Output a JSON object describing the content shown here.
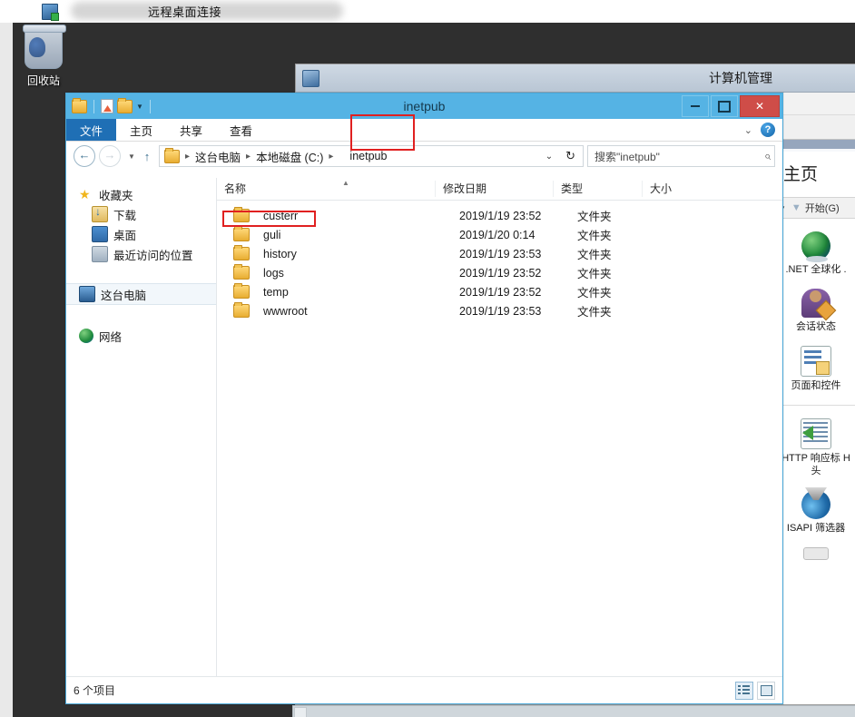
{
  "rdp": {
    "title": "远程桌面连接",
    "icon": "remote-desktop-icon"
  },
  "desktop": {
    "recycle_bin_label": "回收站",
    "recycle_bin_icon": "recycle-bin-icon"
  },
  "computer_management": {
    "title": "计算机管理",
    "icon": "computer-management-icon",
    "home_heading": "主页",
    "filter": {
      "caret_icon": "chevron-down-icon",
      "funnel_icon": "filter-funnel-icon",
      "label": "开始(G)"
    },
    "feature_groups": [
      {
        "items": [
          {
            "icon": "globe-icon",
            "label": ".NET 全球化 ."
          },
          {
            "icon": "session-person-icon",
            "label": "会话状态"
          },
          {
            "icon": "pages-controls-icon",
            "label": "页面和控件"
          }
        ]
      },
      {
        "items": [
          {
            "icon": "http-response-headers-icon",
            "label": "HTTP 响应标 H\n头"
          },
          {
            "icon": "isapi-filter-icon",
            "label": "ISAPI 筛选器"
          }
        ]
      }
    ]
  },
  "explorer": {
    "title": "inetpub",
    "quick_access": [
      {
        "icon": "folder-icon",
        "name": "save-folder-button"
      },
      {
        "icon": "new-document-icon",
        "name": "properties-button"
      },
      {
        "icon": "folder-icon",
        "name": "new-folder-button"
      },
      {
        "icon": "chevron-down-icon",
        "name": "customize-qat-button"
      }
    ],
    "window_buttons": {
      "minimize": "minimize-button",
      "maximize": "maximize-button",
      "close_label": "✕"
    },
    "ribbon_tabs": [
      {
        "label": "文件",
        "active": true
      },
      {
        "label": "主页",
        "active": false
      },
      {
        "label": "共享",
        "active": false
      },
      {
        "label": "查看",
        "active": false
      }
    ],
    "ribbon_right": {
      "collapse_icon": "chevron-down-icon",
      "help_icon": "help-icon",
      "help_glyph": "?"
    },
    "address_bar": {
      "back_glyph": "←",
      "forward_glyph": "→",
      "recent_caret": "▼",
      "up_glyph": "↑",
      "crumbs": [
        "这台电脑",
        "本地磁盘 (C:)",
        "inetpub"
      ],
      "crumb_separator": "▸",
      "dropdown_caret": "⌄",
      "refresh_glyph": "↻"
    },
    "search": {
      "text": "搜索\"inetpub\"",
      "icon": "search-magnifier-icon"
    },
    "nav_pane": [
      {
        "label": "收藏夹",
        "icon": "favorites-star-icon",
        "indent": 0,
        "selected": false
      },
      {
        "label": "下载",
        "icon": "downloads-icon",
        "indent": 1,
        "selected": false
      },
      {
        "label": "桌面",
        "icon": "desktop-icon",
        "indent": 1,
        "selected": false
      },
      {
        "label": "最近访问的位置",
        "icon": "recent-places-icon",
        "indent": 1,
        "selected": false
      },
      {
        "label": "这台电脑",
        "icon": "this-pc-icon",
        "indent": 0,
        "selected": true
      },
      {
        "label": "网络",
        "icon": "network-icon",
        "indent": 0,
        "selected": false
      }
    ],
    "columns": [
      "名称",
      "修改日期",
      "类型",
      "大小"
    ],
    "sort_indicator": "▲",
    "rows": [
      {
        "name": "custerr",
        "date": "2019/1/19 23:52",
        "type": "文件夹",
        "size": ""
      },
      {
        "name": "guli",
        "date": "2019/1/20 0:14",
        "type": "文件夹",
        "size": ""
      },
      {
        "name": "history",
        "date": "2019/1/19 23:53",
        "type": "文件夹",
        "size": ""
      },
      {
        "name": "logs",
        "date": "2019/1/19 23:52",
        "type": "文件夹",
        "size": ""
      },
      {
        "name": "temp",
        "date": "2019/1/19 23:52",
        "type": "文件夹",
        "size": ""
      },
      {
        "name": "wwwroot",
        "date": "2019/1/19 23:53",
        "type": "文件夹",
        "size": ""
      }
    ],
    "status": {
      "item_count_text": "6 个项目",
      "details_view": "details-view-button",
      "large_icons_view": "large-icons-view-button"
    }
  },
  "annotations": {
    "accent_color": "#e02020",
    "boxes": [
      {
        "name": "address-breadcrumb-highlight",
        "target": "inetpub"
      },
      {
        "name": "guli-folder-highlight",
        "target": "guli"
      }
    ]
  },
  "colors": {
    "explorer_title_bar": "#55b3e4",
    "active_tab": "#1f6fb5",
    "close_button": "#cf4d48",
    "desktop": "#2f2f2f",
    "annotation_red": "#e02020"
  }
}
